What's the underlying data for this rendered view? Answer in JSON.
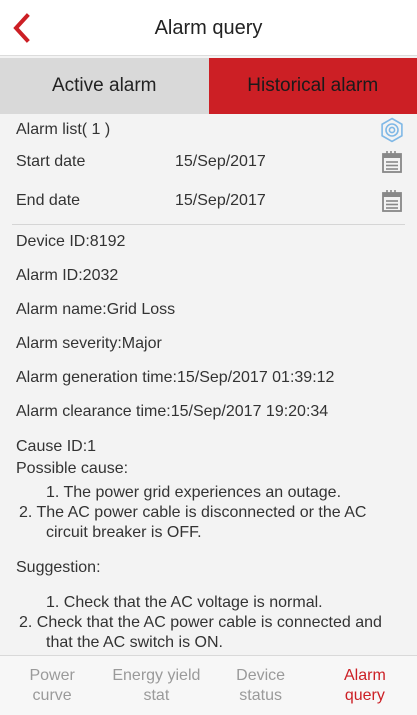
{
  "header": {
    "title": "Alarm query",
    "back_icon": "chevron-left-icon",
    "accent": "#cc1f25"
  },
  "tabs": [
    {
      "label": "Active alarm",
      "selected": false
    },
    {
      "label": "Historical alarm",
      "selected": true
    }
  ],
  "alarm_list": {
    "label": "Alarm list( 1 )",
    "settings_icon": "gear-icon"
  },
  "start_date": {
    "label": "Start date",
    "value": "15/Sep/2017",
    "icon": "calendar-icon"
  },
  "end_date": {
    "label": "End date",
    "value": "15/Sep/2017",
    "icon": "calendar-icon"
  },
  "alarm": {
    "device_id": "Device ID:8192",
    "alarm_id": "Alarm ID:2032",
    "alarm_name": "Alarm name:Grid Loss",
    "severity": "Alarm severity:Major",
    "generation_time": "Alarm generation time:15/Sep/2017 01:39:12",
    "clearance_time": "Alarm clearance time:15/Sep/2017 19:20:34",
    "cause_id": "Cause ID:1",
    "possible_cause_label": "Possible cause:",
    "possible_cause_1": "1. The power grid experiences an outage.",
    "possible_cause_2": "2. The AC power cable is disconnected or the AC circuit breaker is OFF.",
    "suggestion_label": "Suggestion:",
    "suggestion_1": "1. Check that the AC voltage is normal.",
    "suggestion_2": "2. Check that the AC power cable is connected and that the AC switch is ON."
  },
  "bottom_nav": [
    {
      "label": "Power\ncurve",
      "active": false
    },
    {
      "label": "Energy yield\nstat",
      "active": false
    },
    {
      "label": "Device\nstatus",
      "active": false
    },
    {
      "label": "Alarm\nquery",
      "active": true
    }
  ]
}
